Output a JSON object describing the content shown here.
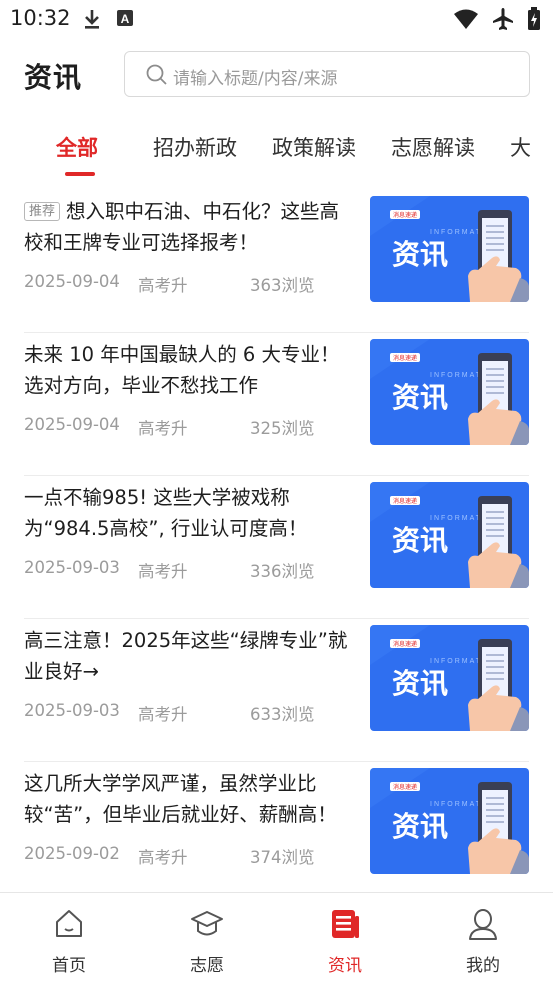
{
  "status_bar": {
    "time": "10:32",
    "left_icons": [
      "download-icon",
      "font-a-icon"
    ],
    "right_icons": [
      "wifi-icon",
      "airplane-icon",
      "battery-charging-icon"
    ]
  },
  "header": {
    "title": "资讯",
    "search_placeholder": "请输入标题/内容/来源"
  },
  "tabs": [
    {
      "label": "全部",
      "active": true
    },
    {
      "label": "招办新政",
      "active": false
    },
    {
      "label": "政策解读",
      "active": false
    },
    {
      "label": "志愿解读",
      "active": false
    },
    {
      "label": "大",
      "active": false
    }
  ],
  "news": [
    {
      "tag": "推荐",
      "title": "想入职中石油、中石化？这些高校和王牌专业可选择报考！",
      "date": "2025-09-04",
      "source": "高考升",
      "views": "363浏览"
    },
    {
      "tag": "",
      "title": "未来 10 年中国最缺人的 6 大专业！选对方向，毕业不愁找工作",
      "date": "2025-09-04",
      "source": "高考升",
      "views": "325浏览"
    },
    {
      "tag": "",
      "title": "一点不输985! 这些大学被戏称为“984.5高校”, 行业认可度高！",
      "date": "2025-09-03",
      "source": "高考升",
      "views": "336浏览"
    },
    {
      "tag": "",
      "title": "高三注意！2025年这些“绿牌专业”就业良好→",
      "date": "2025-09-03",
      "source": "高考升",
      "views": "633浏览"
    },
    {
      "tag": "",
      "title": "这几所大学学风严谨，虽然学业比较“苦”，但毕业后就业好、薪酬高！",
      "date": "2025-09-02",
      "source": "高考升",
      "views": "374浏览"
    }
  ],
  "thumbnail": {
    "badge": "消息速递",
    "watermark": "INFORMATION",
    "text": "资讯"
  },
  "bottom_nav": [
    {
      "label": "首页",
      "icon": "home-icon",
      "active": false
    },
    {
      "label": "志愿",
      "icon": "graduation-cap-icon",
      "active": false
    },
    {
      "label": "资讯",
      "icon": "news-icon",
      "active": true
    },
    {
      "label": "我的",
      "icon": "user-icon",
      "active": false
    }
  ],
  "colors": {
    "accent": "#e02828",
    "thumb_blue": "#2f6ff0",
    "text_gray": "#9b9b9b"
  }
}
